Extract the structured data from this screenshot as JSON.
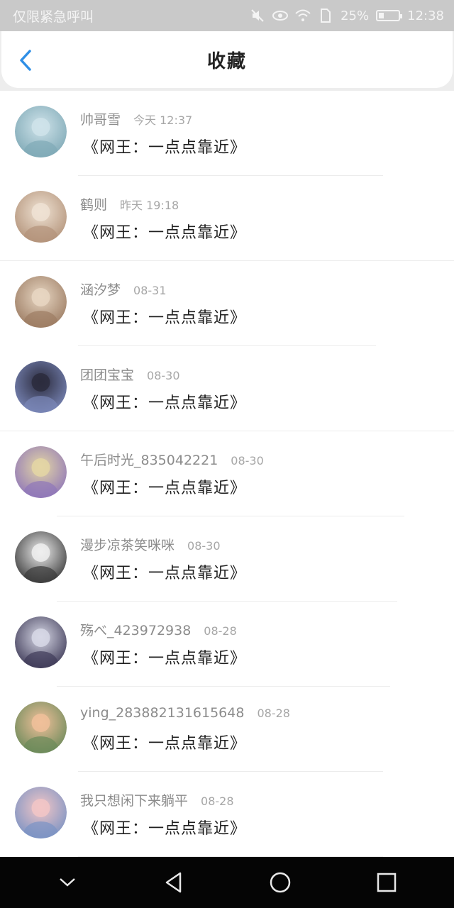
{
  "status_bar": {
    "emergency_text": "仅限紧急呼叫",
    "battery_percent": "25%",
    "battery_level": 0.25,
    "time": "12:38",
    "icons": [
      "mute-icon",
      "eye-icon",
      "wifi-icon",
      "sim-icon",
      "battery-icon"
    ]
  },
  "header": {
    "title": "收藏",
    "back_icon": "chevron-left-icon"
  },
  "items": [
    {
      "name": "帅哥雪",
      "time": "今天 12:37",
      "content": "《网王：一点点靠近》",
      "avatar_colors": [
        "#cfe3ea",
        "#7fa9b6"
      ]
    },
    {
      "name": "鹤则",
      "time": "昨天 19:18",
      "content": "《网王：一点点靠近》",
      "avatar_colors": [
        "#efe2d3",
        "#b3937a"
      ]
    },
    {
      "name": "涵汐梦",
      "time": "08-31",
      "content": "《网王：一点点靠近》",
      "avatar_colors": [
        "#e7d6c2",
        "#9c7c63"
      ]
    },
    {
      "name": "团团宝宝",
      "time": "08-30",
      "content": "《网王：一点点靠近》",
      "avatar_colors": [
        "#2b2b3d",
        "#7a87b8"
      ]
    },
    {
      "name": "午后时光_835042221",
      "time": "08-30",
      "content": "《网王：一点点靠近》",
      "avatar_colors": [
        "#e4d6a5",
        "#8f76b9"
      ]
    },
    {
      "name": "漫步凉茶笑咪咪",
      "time": "08-30",
      "content": "《网王：一点点靠近》",
      "avatar_colors": [
        "#eeeeee",
        "#3a3a3a"
      ]
    },
    {
      "name": "殇べ_423972938",
      "time": "08-28",
      "content": "《网王：一点点靠近》",
      "avatar_colors": [
        "#d7d8e6",
        "#3f3b58"
      ]
    },
    {
      "name": "ying_283882131615648",
      "time": "08-28",
      "content": "《网王：一点点靠近》",
      "avatar_colors": [
        "#f0c09a",
        "#6b8a5a"
      ]
    },
    {
      "name": "我只想闲下来躺平",
      "time": "08-28",
      "content": "《网王：一点点靠近》",
      "avatar_colors": [
        "#f2c6c6",
        "#7b93c4"
      ]
    }
  ],
  "nav_bar": {
    "icons": [
      "collapse-icon",
      "back-icon",
      "home-icon",
      "recent-apps-icon"
    ]
  }
}
